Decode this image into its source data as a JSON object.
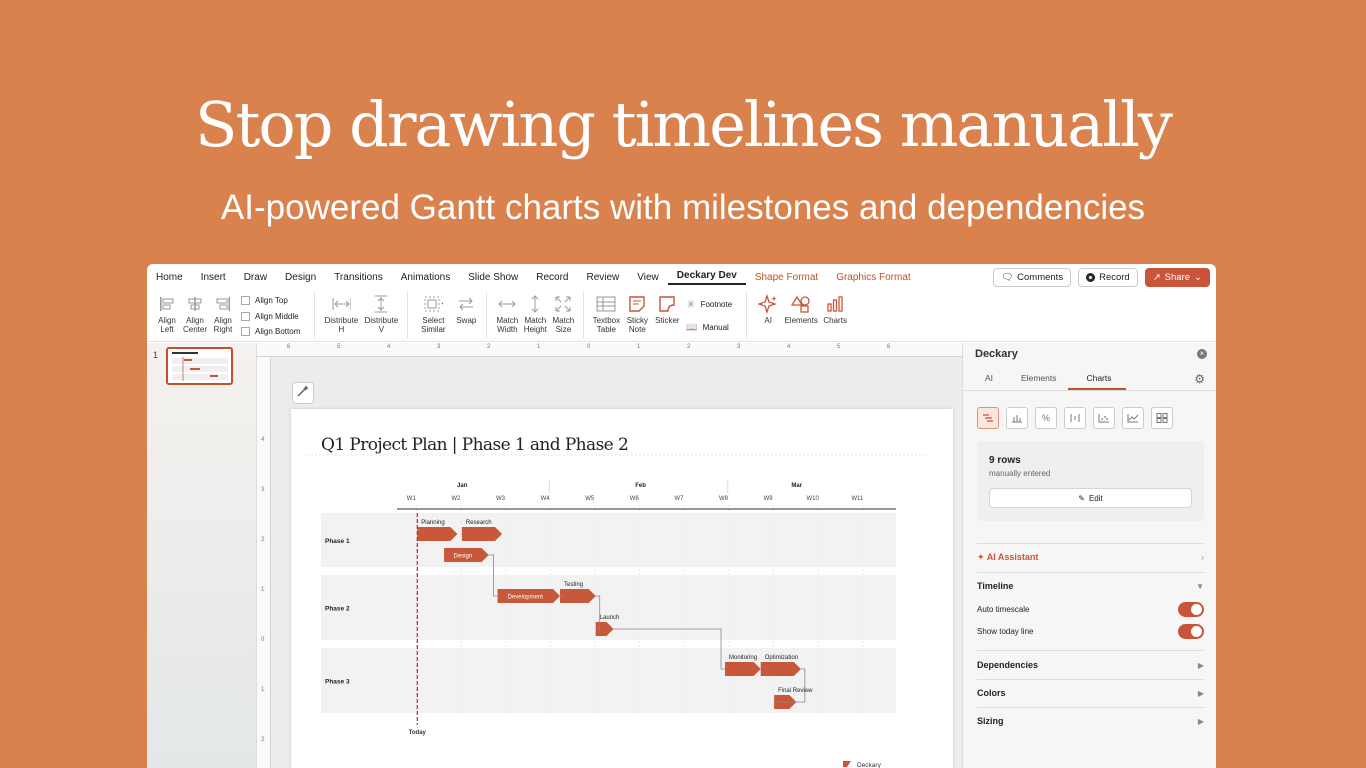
{
  "hero": {
    "title": "Stop drawing timelines manually",
    "subtitle": "AI-powered Gantt charts with milestones and dependencies"
  },
  "menu": {
    "tabs": [
      "Home",
      "Insert",
      "Draw",
      "Design",
      "Transitions",
      "Animations",
      "Slide Show",
      "Record",
      "Review",
      "View",
      "Deckary Dev",
      "Shape Format",
      "Graphics Format"
    ],
    "active_tab": "Deckary Dev",
    "comments": "Comments",
    "record": "Record",
    "share": "Share"
  },
  "ribbon": {
    "align_left": "Align Left",
    "align_center": "Align Center",
    "align_right": "Align Right",
    "align_top": "Align Top",
    "align_middle": "Align Middle",
    "align_bottom": "Align Bottom",
    "distribute_h": "Distribute H",
    "distribute_v": "Distribute V",
    "select_similar": "Select Similar",
    "swap": "Swap",
    "match_width": "Match Width",
    "match_height": "Match Height",
    "match_size": "Match Size",
    "textbox_table": "Textbox Table",
    "sticky_note": "Sticky Note",
    "sticker": "Sticker",
    "footnote": "Footnote",
    "manual": "Manual",
    "ai": "AI",
    "elements": "Elements",
    "charts": "Charts"
  },
  "slides": {
    "current_number": "1"
  },
  "rulers": {
    "h_labels": [
      "6",
      "5",
      "4",
      "3",
      "2",
      "1",
      "0",
      "1",
      "2",
      "3",
      "4",
      "5",
      "6"
    ],
    "v_labels": [
      "4",
      "3",
      "2",
      "1",
      "0",
      "1",
      "2",
      "3"
    ]
  },
  "slide": {
    "title": "Q1 Project Plan | Phase 1 and Phase 2",
    "watermark": "Deckary"
  },
  "chart_data": {
    "type": "gantt",
    "months": [
      {
        "label": "Jan",
        "weeks": [
          "W1",
          "W2",
          "W3",
          "W4"
        ]
      },
      {
        "label": "Feb",
        "weeks": [
          "W5",
          "W6",
          "W7",
          "W8"
        ]
      },
      {
        "label": "Mar",
        "weeks": [
          "W9",
          "W10",
          "W11"
        ]
      }
    ],
    "weeks": [
      "W1",
      "W2",
      "W3",
      "W4",
      "W5",
      "W6",
      "W7",
      "W8",
      "W9",
      "W10",
      "W11"
    ],
    "phases": [
      "Phase 1",
      "Phase 2",
      "Phase 3"
    ],
    "today_label": "Today",
    "today_week": 1.5,
    "tasks": [
      {
        "name": "Planning",
        "phase": "Phase 1",
        "start": 1.5,
        "end": 2.4,
        "label_inside": false
      },
      {
        "name": "Research",
        "phase": "Phase 1",
        "start": 2.5,
        "end": 3.4,
        "label_inside": false
      },
      {
        "name": "Design",
        "phase": "Phase 1",
        "start": 2.1,
        "end": 3.1,
        "label_inside": true
      },
      {
        "name": "Development",
        "phase": "Phase 2",
        "start": 3.3,
        "end": 4.7,
        "label_inside": true
      },
      {
        "name": "Testing",
        "phase": "Phase 2",
        "start": 4.7,
        "end": 5.5,
        "label_inside": false
      },
      {
        "name": "Launch",
        "phase": "Phase 2",
        "start": 5.5,
        "end": 5.9,
        "label_inside": false
      },
      {
        "name": "Monitoring",
        "phase": "Phase 3",
        "start": 8.4,
        "end": 9.2,
        "label_inside": false
      },
      {
        "name": "Optimization",
        "phase": "Phase 3",
        "start": 9.2,
        "end": 10.1,
        "label_inside": false
      },
      {
        "name": "Final Review",
        "phase": "Phase 3",
        "start": 9.5,
        "end": 10.0,
        "label_inside": false
      }
    ],
    "colors": {
      "bar": "#C9583B",
      "today": "#A33A2A",
      "band": "#F2F2F2"
    }
  },
  "panel": {
    "title": "Deckary",
    "tabs": [
      "AI",
      "Elements",
      "Charts"
    ],
    "active_tab": "Charts",
    "rows_count": "9 rows",
    "rows_source": "manually entered",
    "edit_label": "Edit",
    "ai_assistant": "AI Assistant",
    "timeline": "Timeline",
    "auto_timescale": "Auto timescale",
    "show_today_line": "Show today line",
    "dependencies": "Dependencies",
    "colors": "Colors",
    "sizing": "Sizing"
  },
  "accent": "#C9543A"
}
